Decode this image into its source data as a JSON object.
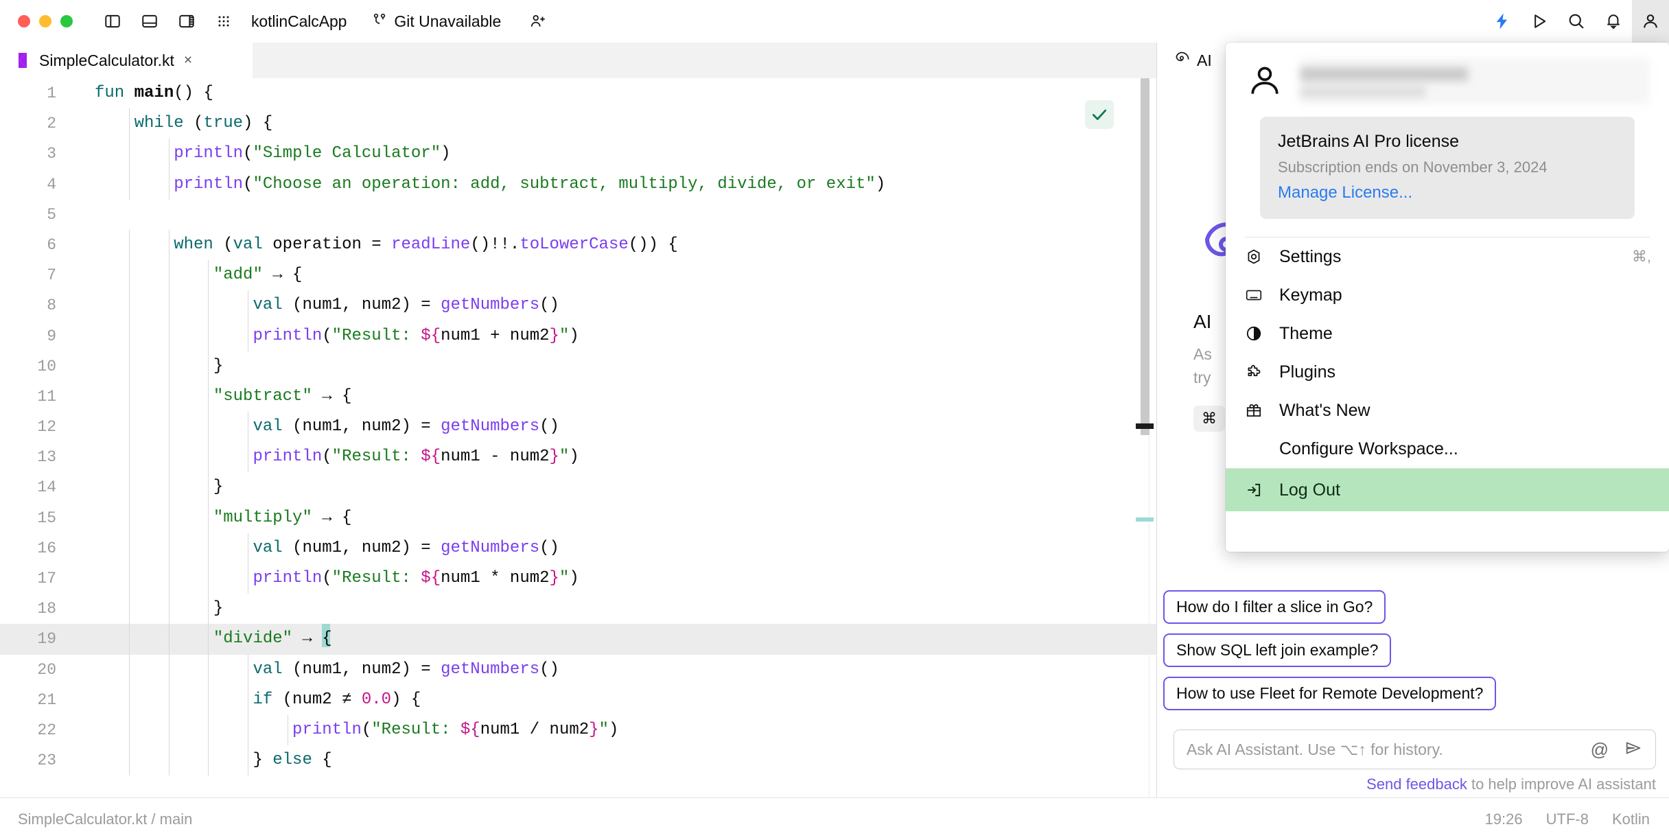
{
  "titlebar": {
    "project_name": "kotlinCalcApp",
    "git_status": "Git Unavailable",
    "icons": {
      "left_panel": "left-panel-icon",
      "bottom_panel": "bottom-panel-icon",
      "right_panel": "right-panel-icon",
      "grid": "grid-icon",
      "git": "git-branch-icon",
      "add_person": "add-person-icon",
      "ai_bolt": "ai-bolt-icon",
      "run": "run-icon",
      "search": "search-icon",
      "notifications": "bell-icon",
      "account": "account-icon"
    }
  },
  "editor": {
    "tab_label": "SimpleCalculator.kt",
    "tab_close": "×",
    "lines": [
      {
        "n": "1",
        "html": "<span class=\"k\">fun</span> <span class=\"bold\">main</span>() {"
      },
      {
        "n": "2",
        "html": "    <span class=\"k\">while</span> (<span class=\"k\">true</span>) {"
      },
      {
        "n": "3",
        "html": "        <span class=\"fn\">println</span>(<span class=\"str\">\"Simple Calculator\"</span>)"
      },
      {
        "n": "4",
        "html": "        <span class=\"fn\">println</span>(<span class=\"str\">\"Choose an operation: add, subtract, multiply, divide, or exit\"</span>)"
      },
      {
        "n": "5",
        "html": ""
      },
      {
        "n": "6",
        "html": "        <span class=\"k\">when</span> (<span class=\"k\">val</span> operation = <span class=\"fn\">readLine</span>()!!.<span class=\"fn\">toLowerCase</span>()) {"
      },
      {
        "n": "7",
        "html": "            <span class=\"str\">\"add\"</span> → {"
      },
      {
        "n": "8",
        "html": "                <span class=\"k\">val</span> (num1, num2) = <span class=\"fn\">getNumbers</span>()"
      },
      {
        "n": "9",
        "html": "                <span class=\"fn\">println</span>(<span class=\"str\">\"Result: </span><span class=\"tmpl\">${</span>num1 + num2<span class=\"tmpl\">}</span><span class=\"str\">\"</span>)"
      },
      {
        "n": "10",
        "html": "            }"
      },
      {
        "n": "11",
        "html": "            <span class=\"str\">\"subtract\"</span> → {"
      },
      {
        "n": "12",
        "html": "                <span class=\"k\">val</span> (num1, num2) = <span class=\"fn\">getNumbers</span>()"
      },
      {
        "n": "13",
        "html": "                <span class=\"fn\">println</span>(<span class=\"str\">\"Result: </span><span class=\"tmpl\">${</span>num1 - num2<span class=\"tmpl\">}</span><span class=\"str\">\"</span>)"
      },
      {
        "n": "14",
        "html": "            }"
      },
      {
        "n": "15",
        "html": "            <span class=\"str\">\"multiply\"</span> → {"
      },
      {
        "n": "16",
        "html": "                <span class=\"k\">val</span> (num1, num2) = <span class=\"fn\">getNumbers</span>()"
      },
      {
        "n": "17",
        "html": "                <span class=\"fn\">println</span>(<span class=\"str\">\"Result: </span><span class=\"tmpl\">${</span>num1 * num2<span class=\"tmpl\">}</span><span class=\"str\">\"</span>)"
      },
      {
        "n": "18",
        "html": "            }"
      },
      {
        "n": "19",
        "html": "            <span class=\"str\">\"divide\"</span> → <span class=\"caret\"></span>{",
        "current": true
      },
      {
        "n": "20",
        "html": "                <span class=\"k\">val</span> (num1, num2) = <span class=\"fn\">getNumbers</span>()"
      },
      {
        "n": "21",
        "html": "                <span class=\"k\">if</span> (num2 ≠ <span class=\"num\">0.0</span>) {"
      },
      {
        "n": "22",
        "html": "                    <span class=\"fn\">println</span>(<span class=\"str\">\"Result: </span><span class=\"tmpl\">${</span>num1 / num2<span class=\"tmpl\">}</span><span class=\"str\">\"</span>)"
      },
      {
        "n": "23",
        "html": "                } <span class=\"k\">else</span> {"
      }
    ],
    "inspection_status": "ok-check-icon"
  },
  "ai_panel": {
    "tab_label": "AI ",
    "title": "AI",
    "subtitle_line1": "As",
    "subtitle_line2": "try",
    "kbd": "⌘",
    "suggestions": [
      "How do I filter a slice in Go?",
      "Show SQL left join example?",
      "How to use Fleet for Remote Development?"
    ],
    "ask_placeholder": "Ask AI Assistant. Use ⌥↑ for history.",
    "at_icon": "@",
    "send_icon": "send-icon",
    "feedback_link": "Send feedback",
    "feedback_rest": " to help improve AI assistant"
  },
  "account_menu": {
    "license_title": "JetBrains AI Pro license",
    "license_sub": "Subscription ends on November 3, 2024",
    "license_link": "Manage License...",
    "items": [
      {
        "label": "Settings",
        "icon": "gear-icon",
        "shortcut": "⌘,"
      },
      {
        "label": "Keymap",
        "icon": "keyboard-icon",
        "shortcut": ""
      },
      {
        "label": "Theme",
        "icon": "theme-icon",
        "shortcut": ""
      },
      {
        "label": "Plugins",
        "icon": "puzzle-icon",
        "shortcut": ""
      },
      {
        "label": "What's New",
        "icon": "gift-icon",
        "shortcut": ""
      },
      {
        "label": "Configure Workspace...",
        "icon": "",
        "shortcut": ""
      }
    ],
    "logout_label": "Log Out",
    "logout_icon": "logout-icon",
    "logout_highlight_color": "#b5e5bd"
  },
  "statusbar": {
    "path": "SimpleCalculator.kt / main",
    "time": "19:26",
    "encoding": "UTF-8",
    "language": "Kotlin"
  },
  "colors": {
    "accent_blue": "#2a7bf0",
    "accent_purple": "#6b57e8",
    "kotlin_purple": "#a020f0",
    "string_green": "#1a7a1f",
    "keyword_teal": "#0b6a6d"
  }
}
